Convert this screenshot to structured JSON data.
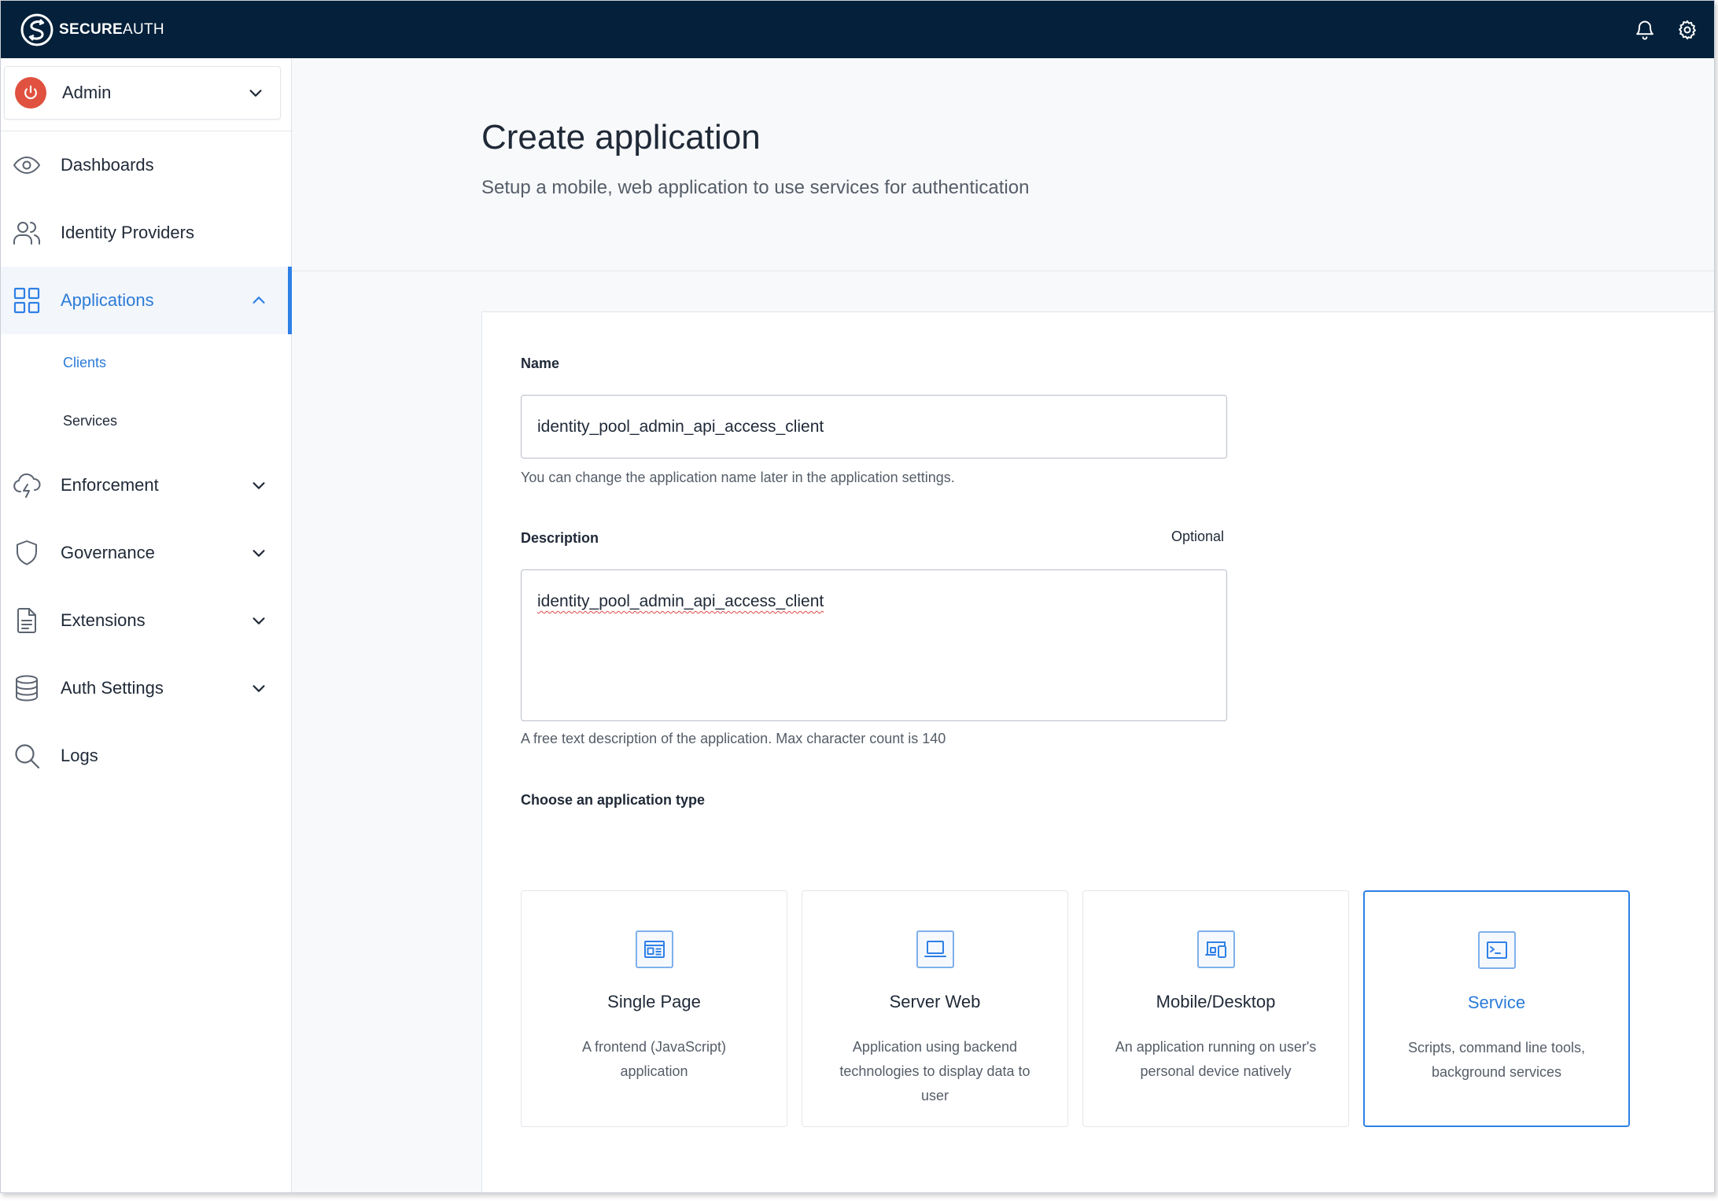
{
  "brand": {
    "name_bold": "SECURE",
    "name_light": "AUTH"
  },
  "topbar": {
    "notifications_icon": "bell-icon",
    "settings_icon": "gear-icon"
  },
  "sidebar": {
    "tenant": {
      "label": "Admin",
      "icon": "power-icon"
    },
    "items": [
      {
        "label": "Dashboards",
        "icon": "eye-icon"
      },
      {
        "label": "Identity Providers",
        "icon": "users-icon"
      },
      {
        "label": "Applications",
        "icon": "grid-icon",
        "active": true,
        "children": [
          {
            "label": "Clients",
            "active": true
          },
          {
            "label": "Services"
          }
        ]
      },
      {
        "label": "Enforcement",
        "icon": "cloud-bolt-icon"
      },
      {
        "label": "Governance",
        "icon": "shield-icon"
      },
      {
        "label": "Extensions",
        "icon": "document-icon"
      },
      {
        "label": "Auth Settings",
        "icon": "database-icon"
      },
      {
        "label": "Logs",
        "icon": "search-icon"
      }
    ]
  },
  "page": {
    "title": "Create application",
    "subtitle": "Setup a mobile, web application to use services for authentication"
  },
  "form": {
    "name": {
      "label": "Name",
      "value": "identity_pool_admin_api_access_client",
      "helper": "You can change the application name later in the application settings."
    },
    "description": {
      "label": "Description",
      "optional": "Optional",
      "value": "identity_pool_admin_api_access_client",
      "helper": "A free text description of the application. Max character count is 140"
    },
    "app_type": {
      "label": "Choose an application type",
      "options": [
        {
          "title": "Single Page",
          "description": "A frontend (JavaScript) application",
          "icon": "browser-window-icon"
        },
        {
          "title": "Server Web",
          "description": "Application using backend technologies to display data to user",
          "icon": "laptop-icon"
        },
        {
          "title": "Mobile/Desktop",
          "description": "An application running on user's personal device natively",
          "icon": "devices-icon"
        },
        {
          "title": "Service",
          "description": "Scripts, command line tools, background services",
          "icon": "terminal-icon",
          "selected": true
        }
      ]
    }
  },
  "colors": {
    "accent": "#2f80e6",
    "topbar": "#04203a",
    "power": "#e0513f"
  }
}
